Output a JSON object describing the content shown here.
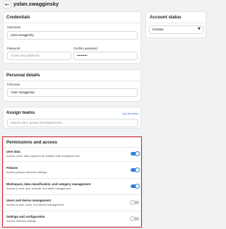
{
  "header": {
    "title": "yolan.swagginsky"
  },
  "credentials": {
    "heading": "Credentials",
    "username_label": "Username",
    "username_value": "yolan.swagginsky",
    "password_label": "Password",
    "password_placeholder": "Create new password",
    "confirm_label": "Confirm password",
    "confirm_value": "••••••••••"
  },
  "personal": {
    "heading": "Personal details",
    "fullname_label": "Full name",
    "fullname_value": "Yolan Swagginsky"
  },
  "teams": {
    "heading": "Assign teams",
    "list_link": "List all teams",
    "search_placeholder": "Search users, groups and departments..."
  },
  "account_status": {
    "heading": "Account status",
    "selected": "Enabled"
  },
  "permissions": {
    "heading": "Permissions and access",
    "items": [
      {
        "title": "User data",
        "desc": "Access users' data captured by Safetica with analytical tools",
        "enabled": true
      },
      {
        "title": "Policies",
        "desc": "Access policies and their settings",
        "enabled": true
      },
      {
        "title": "Workspace, data classification, and category management",
        "desc": "Access to web, app, website, and audit management",
        "enabled": true
      },
      {
        "title": "Users and device management",
        "desc": "Access to user, team, and device management",
        "enabled": false
      },
      {
        "title": "Settings and configuration",
        "desc": "Access Safetica settings",
        "enabled": false
      }
    ]
  },
  "colors": {
    "accent": "#2f7fd6",
    "highlight": "#d4232b"
  }
}
